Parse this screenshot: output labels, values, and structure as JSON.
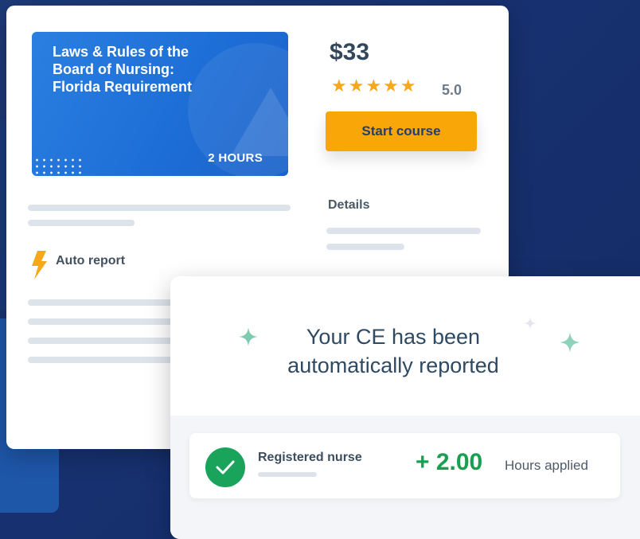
{
  "course": {
    "title": "Laws & Rules of the\nBoard of Nursing:\nFlorida Requirement",
    "hours_badge": "2 HOURS",
    "price": "$33",
    "stars": "★★★★★",
    "rating": "5.0",
    "start_label": "Start course",
    "details_label": "Details",
    "auto_report_label": "Auto report"
  },
  "notification": {
    "message": "Your CE has been\nautomatically reported",
    "role": "Registered nurse",
    "hours_value": "+ 2.00",
    "hours_label": "Hours applied"
  },
  "colors": {
    "background": "#1d3a78",
    "thumbnail": "#2a7fe0",
    "button": "#f9a609",
    "stars": "#f7a81a",
    "success": "#16a050",
    "sparkle": "#7ecbb0"
  },
  "icons": {
    "bolt": "bolt-icon",
    "check": "check-icon",
    "sparkle": "sparkle-icon"
  }
}
